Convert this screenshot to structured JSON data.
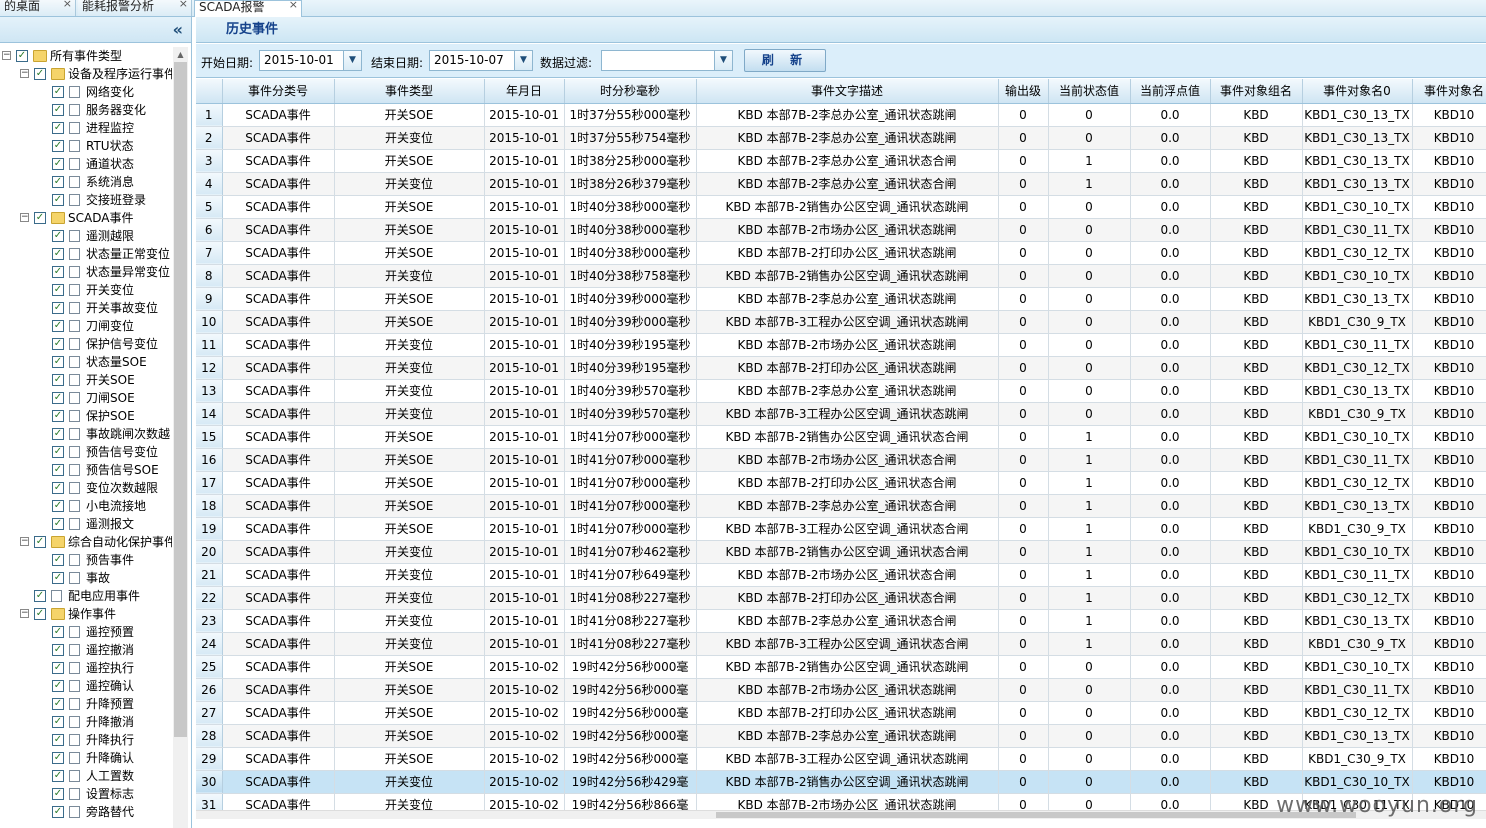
{
  "tabs": [
    {
      "label": "的桌面",
      "active": false
    },
    {
      "label": "能耗报警分析",
      "active": false
    },
    {
      "label": "SCADA报警",
      "active": true
    }
  ],
  "tree": [
    {
      "level": 0,
      "type": "folder",
      "expand": "−",
      "label": "所有事件类型"
    },
    {
      "level": 1,
      "type": "folder",
      "expand": "−",
      "label": "设备及程序运行事件"
    },
    {
      "level": 2,
      "type": "doc",
      "label": "网络变化"
    },
    {
      "level": 2,
      "type": "doc",
      "label": "服务器变化"
    },
    {
      "level": 2,
      "type": "doc",
      "label": "进程监控"
    },
    {
      "level": 2,
      "type": "doc",
      "label": "RTU状态"
    },
    {
      "level": 2,
      "type": "doc",
      "label": "通道状态"
    },
    {
      "level": 2,
      "type": "doc",
      "label": "系统消息"
    },
    {
      "level": 2,
      "type": "doc",
      "label": "交接班登录"
    },
    {
      "level": 1,
      "type": "folder",
      "expand": "−",
      "label": "SCADA事件"
    },
    {
      "level": 2,
      "type": "doc",
      "label": "遥测越限"
    },
    {
      "level": 2,
      "type": "doc",
      "label": "状态量正常变位"
    },
    {
      "level": 2,
      "type": "doc",
      "label": "状态量异常变位"
    },
    {
      "level": 2,
      "type": "doc",
      "label": "开关变位"
    },
    {
      "level": 2,
      "type": "doc",
      "label": "开关事故变位"
    },
    {
      "level": 2,
      "type": "doc",
      "label": "刀闸变位"
    },
    {
      "level": 2,
      "type": "doc",
      "label": "保护信号变位"
    },
    {
      "level": 2,
      "type": "doc",
      "label": "状态量SOE"
    },
    {
      "level": 2,
      "type": "doc",
      "label": "开关SOE"
    },
    {
      "level": 2,
      "type": "doc",
      "label": "刀闸SOE"
    },
    {
      "level": 2,
      "type": "doc",
      "label": "保护SOE"
    },
    {
      "level": 2,
      "type": "doc",
      "label": "事故跳闸次数越"
    },
    {
      "level": 2,
      "type": "doc",
      "label": "预告信号变位"
    },
    {
      "level": 2,
      "type": "doc",
      "label": "预告信号SOE"
    },
    {
      "level": 2,
      "type": "doc",
      "label": "变位次数越限"
    },
    {
      "level": 2,
      "type": "doc",
      "label": "小电流接地"
    },
    {
      "level": 2,
      "type": "doc",
      "label": "遥测报文"
    },
    {
      "level": 1,
      "type": "folder",
      "expand": "−",
      "label": "综合自动化保护事件"
    },
    {
      "level": 2,
      "type": "doc",
      "label": "预告事件"
    },
    {
      "level": 2,
      "type": "doc",
      "label": "事故"
    },
    {
      "level": 1,
      "type": "doc",
      "label": "配电应用事件"
    },
    {
      "level": 1,
      "type": "folder",
      "expand": "−",
      "label": "操作事件"
    },
    {
      "level": 2,
      "type": "doc",
      "label": "遥控预置"
    },
    {
      "level": 2,
      "type": "doc",
      "label": "遥控撤消"
    },
    {
      "level": 2,
      "type": "doc",
      "label": "遥控执行"
    },
    {
      "level": 2,
      "type": "doc",
      "label": "遥控确认"
    },
    {
      "level": 2,
      "type": "doc",
      "label": "升降预置"
    },
    {
      "level": 2,
      "type": "doc",
      "label": "升降撤消"
    },
    {
      "level": 2,
      "type": "doc",
      "label": "升降执行"
    },
    {
      "level": 2,
      "type": "doc",
      "label": "升降确认"
    },
    {
      "level": 2,
      "type": "doc",
      "label": "人工置数"
    },
    {
      "level": 2,
      "type": "doc",
      "label": "设置标志"
    },
    {
      "level": 2,
      "type": "doc",
      "label": "旁路替代"
    }
  ],
  "panel": {
    "title": "历史事件",
    "collapse_icon": "«"
  },
  "toolbar": {
    "start_label": "开始日期:",
    "start_value": "2015-10-01",
    "end_label": "结束日期:",
    "end_value": "2015-10-07",
    "filter_label": "数据过滤:",
    "filter_value": "",
    "refresh_label": "刷 新"
  },
  "columns": [
    "",
    "事件分类号",
    "事件类型",
    "年月日",
    "时分秒毫秒",
    "事件文字描述",
    "输出级",
    "当前状态值",
    "当前浮点值",
    "事件对象组名",
    "事件对象名0",
    "事件对象名"
  ],
  "rows": [
    [
      "1",
      "SCADA事件",
      "开关SOE",
      "2015-10-01",
      "1时37分55秒000毫秒",
      "KBD 本部7B-2李总办公室_通讯状态跳闸",
      "0",
      "0",
      "0.0",
      "KBD",
      "KBD1_C30_13_TX",
      "KBD10"
    ],
    [
      "2",
      "SCADA事件",
      "开关变位",
      "2015-10-01",
      "1时37分55秒754毫秒",
      "KBD 本部7B-2李总办公室_通讯状态跳闸",
      "0",
      "0",
      "0.0",
      "KBD",
      "KBD1_C30_13_TX",
      "KBD10"
    ],
    [
      "3",
      "SCADA事件",
      "开关SOE",
      "2015-10-01",
      "1时38分25秒000毫秒",
      "KBD 本部7B-2李总办公室_通讯状态合闸",
      "0",
      "1",
      "0.0",
      "KBD",
      "KBD1_C30_13_TX",
      "KBD10"
    ],
    [
      "4",
      "SCADA事件",
      "开关变位",
      "2015-10-01",
      "1时38分26秒379毫秒",
      "KBD 本部7B-2李总办公室_通讯状态合闸",
      "0",
      "1",
      "0.0",
      "KBD",
      "KBD1_C30_13_TX",
      "KBD10"
    ],
    [
      "5",
      "SCADA事件",
      "开关SOE",
      "2015-10-01",
      "1时40分38秒000毫秒",
      "KBD 本部7B-2销售办公区空调_通讯状态跳闸",
      "0",
      "0",
      "0.0",
      "KBD",
      "KBD1_C30_10_TX",
      "KBD10"
    ],
    [
      "6",
      "SCADA事件",
      "开关SOE",
      "2015-10-01",
      "1时40分38秒000毫秒",
      "KBD 本部7B-2市场办公区_通讯状态跳闸",
      "0",
      "0",
      "0.0",
      "KBD",
      "KBD1_C30_11_TX",
      "KBD10"
    ],
    [
      "7",
      "SCADA事件",
      "开关SOE",
      "2015-10-01",
      "1时40分38秒000毫秒",
      "KBD 本部7B-2打印办公区_通讯状态跳闸",
      "0",
      "0",
      "0.0",
      "KBD",
      "KBD1_C30_12_TX",
      "KBD10"
    ],
    [
      "8",
      "SCADA事件",
      "开关变位",
      "2015-10-01",
      "1时40分38秒758毫秒",
      "KBD 本部7B-2销售办公区空调_通讯状态跳闸",
      "0",
      "0",
      "0.0",
      "KBD",
      "KBD1_C30_10_TX",
      "KBD10"
    ],
    [
      "9",
      "SCADA事件",
      "开关SOE",
      "2015-10-01",
      "1时40分39秒000毫秒",
      "KBD 本部7B-2李总办公室_通讯状态跳闸",
      "0",
      "0",
      "0.0",
      "KBD",
      "KBD1_C30_13_TX",
      "KBD10"
    ],
    [
      "10",
      "SCADA事件",
      "开关SOE",
      "2015-10-01",
      "1时40分39秒000毫秒",
      "KBD 本部7B-3工程办公区空调_通讯状态跳闸",
      "0",
      "0",
      "0.0",
      "KBD",
      "KBD1_C30_9_TX",
      "KBD10"
    ],
    [
      "11",
      "SCADA事件",
      "开关变位",
      "2015-10-01",
      "1时40分39秒195毫秒",
      "KBD 本部7B-2市场办公区_通讯状态跳闸",
      "0",
      "0",
      "0.0",
      "KBD",
      "KBD1_C30_11_TX",
      "KBD10"
    ],
    [
      "12",
      "SCADA事件",
      "开关变位",
      "2015-10-01",
      "1时40分39秒195毫秒",
      "KBD 本部7B-2打印办公区_通讯状态跳闸",
      "0",
      "0",
      "0.0",
      "KBD",
      "KBD1_C30_12_TX",
      "KBD10"
    ],
    [
      "13",
      "SCADA事件",
      "开关变位",
      "2015-10-01",
      "1时40分39秒570毫秒",
      "KBD 本部7B-2李总办公室_通讯状态跳闸",
      "0",
      "0",
      "0.0",
      "KBD",
      "KBD1_C30_13_TX",
      "KBD10"
    ],
    [
      "14",
      "SCADA事件",
      "开关变位",
      "2015-10-01",
      "1时40分39秒570毫秒",
      "KBD 本部7B-3工程办公区空调_通讯状态跳闸",
      "0",
      "0",
      "0.0",
      "KBD",
      "KBD1_C30_9_TX",
      "KBD10"
    ],
    [
      "15",
      "SCADA事件",
      "开关SOE",
      "2015-10-01",
      "1时41分07秒000毫秒",
      "KBD 本部7B-2销售办公区空调_通讯状态合闸",
      "0",
      "1",
      "0.0",
      "KBD",
      "KBD1_C30_10_TX",
      "KBD10"
    ],
    [
      "16",
      "SCADA事件",
      "开关SOE",
      "2015-10-01",
      "1时41分07秒000毫秒",
      "KBD 本部7B-2市场办公区_通讯状态合闸",
      "0",
      "1",
      "0.0",
      "KBD",
      "KBD1_C30_11_TX",
      "KBD10"
    ],
    [
      "17",
      "SCADA事件",
      "开关SOE",
      "2015-10-01",
      "1时41分07秒000毫秒",
      "KBD 本部7B-2打印办公区_通讯状态合闸",
      "0",
      "1",
      "0.0",
      "KBD",
      "KBD1_C30_12_TX",
      "KBD10"
    ],
    [
      "18",
      "SCADA事件",
      "开关SOE",
      "2015-10-01",
      "1时41分07秒000毫秒",
      "KBD 本部7B-2李总办公室_通讯状态合闸",
      "0",
      "1",
      "0.0",
      "KBD",
      "KBD1_C30_13_TX",
      "KBD10"
    ],
    [
      "19",
      "SCADA事件",
      "开关SOE",
      "2015-10-01",
      "1时41分07秒000毫秒",
      "KBD 本部7B-3工程办公区空调_通讯状态合闸",
      "0",
      "1",
      "0.0",
      "KBD",
      "KBD1_C30_9_TX",
      "KBD10"
    ],
    [
      "20",
      "SCADA事件",
      "开关变位",
      "2015-10-01",
      "1时41分07秒462毫秒",
      "KBD 本部7B-2销售办公区空调_通讯状态合闸",
      "0",
      "1",
      "0.0",
      "KBD",
      "KBD1_C30_10_TX",
      "KBD10"
    ],
    [
      "21",
      "SCADA事件",
      "开关变位",
      "2015-10-01",
      "1时41分07秒649毫秒",
      "KBD 本部7B-2市场办公区_通讯状态合闸",
      "0",
      "1",
      "0.0",
      "KBD",
      "KBD1_C30_11_TX",
      "KBD10"
    ],
    [
      "22",
      "SCADA事件",
      "开关变位",
      "2015-10-01",
      "1时41分08秒227毫秒",
      "KBD 本部7B-2打印办公区_通讯状态合闸",
      "0",
      "1",
      "0.0",
      "KBD",
      "KBD1_C30_12_TX",
      "KBD10"
    ],
    [
      "23",
      "SCADA事件",
      "开关变位",
      "2015-10-01",
      "1时41分08秒227毫秒",
      "KBD 本部7B-2李总办公室_通讯状态合闸",
      "0",
      "1",
      "0.0",
      "KBD",
      "KBD1_C30_13_TX",
      "KBD10"
    ],
    [
      "24",
      "SCADA事件",
      "开关变位",
      "2015-10-01",
      "1时41分08秒227毫秒",
      "KBD 本部7B-3工程办公区空调_通讯状态合闸",
      "0",
      "1",
      "0.0",
      "KBD",
      "KBD1_C30_9_TX",
      "KBD10"
    ],
    [
      "25",
      "SCADA事件",
      "开关SOE",
      "2015-10-02",
      "19时42分56秒000毫",
      "KBD 本部7B-2销售办公区空调_通讯状态跳闸",
      "0",
      "0",
      "0.0",
      "KBD",
      "KBD1_C30_10_TX",
      "KBD10"
    ],
    [
      "26",
      "SCADA事件",
      "开关SOE",
      "2015-10-02",
      "19时42分56秒000毫",
      "KBD 本部7B-2市场办公区_通讯状态跳闸",
      "0",
      "0",
      "0.0",
      "KBD",
      "KBD1_C30_11_TX",
      "KBD10"
    ],
    [
      "27",
      "SCADA事件",
      "开关SOE",
      "2015-10-02",
      "19时42分56秒000毫",
      "KBD 本部7B-2打印办公区_通讯状态跳闸",
      "0",
      "0",
      "0.0",
      "KBD",
      "KBD1_C30_12_TX",
      "KBD10"
    ],
    [
      "28",
      "SCADA事件",
      "开关SOE",
      "2015-10-02",
      "19时42分56秒000毫",
      "KBD 本部7B-2李总办公室_通讯状态跳闸",
      "0",
      "0",
      "0.0",
      "KBD",
      "KBD1_C30_13_TX",
      "KBD10"
    ],
    [
      "29",
      "SCADA事件",
      "开关SOE",
      "2015-10-02",
      "19时42分56秒000毫",
      "KBD 本部7B-3工程办公区空调_通讯状态跳闸",
      "0",
      "0",
      "0.0",
      "KBD",
      "KBD1_C30_9_TX",
      "KBD10"
    ],
    [
      "30",
      "SCADA事件",
      "开关变位",
      "2015-10-02",
      "19时42分56秒429毫",
      "KBD 本部7B-2销售办公区空调_通讯状态跳闸",
      "0",
      "0",
      "0.0",
      "KBD",
      "KBD1_C30_10_TX",
      "KBD10"
    ],
    [
      "31",
      "SCADA事件",
      "开关变位",
      "2015-10-02",
      "19时42分56秒866毫",
      "KBD 本部7B-2市场办公区_通讯状态跳闸",
      "0",
      "0",
      "0.0",
      "KBD",
      "KBD1_C30_11_TX",
      "KBD10"
    ]
  ],
  "selected_row": "30",
  "watermark": "www.wooyun.org"
}
